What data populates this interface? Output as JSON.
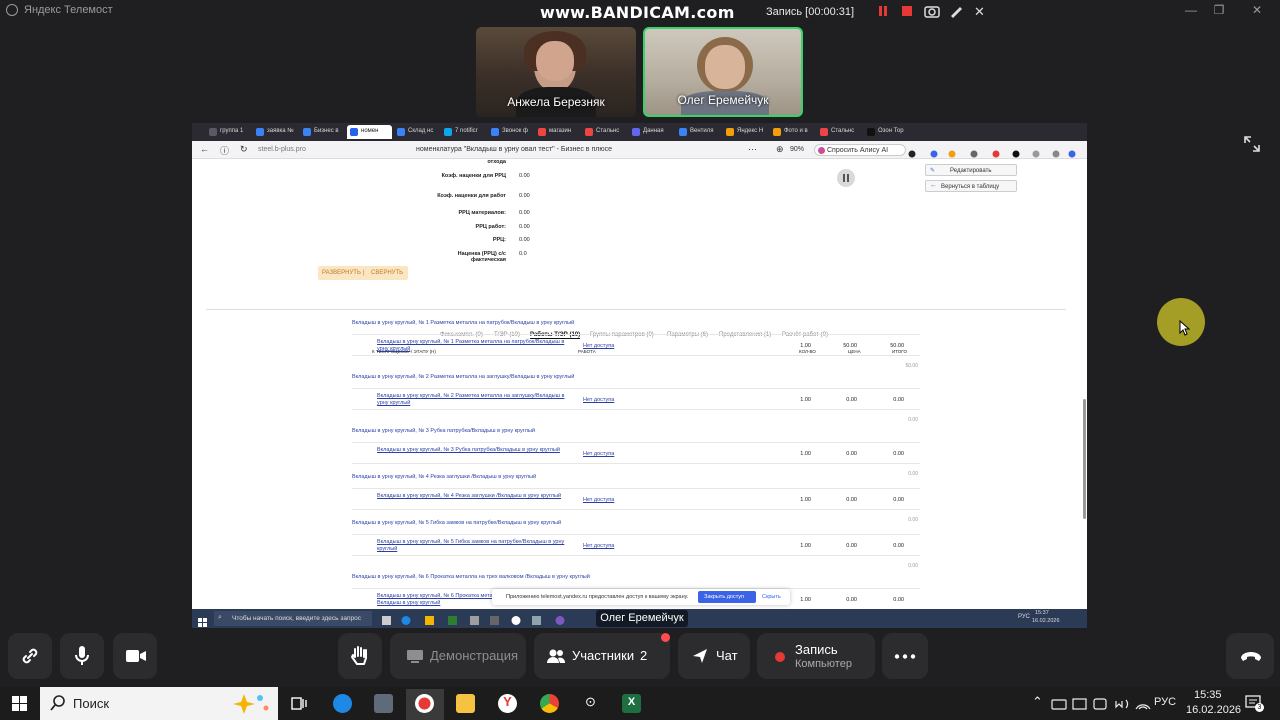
{
  "app": {
    "title": "Яндекс Телемост"
  },
  "bandicam": {
    "brand": "www.BANDICAM.com",
    "recording": "Запись [00:00:31]"
  },
  "participants": [
    {
      "name": "Анжела Березняк"
    },
    {
      "name": "Олег Еремейчук"
    }
  ],
  "shared": {
    "presenter_label": "Олег Еремейчук",
    "tabs": [
      {
        "label": "группа 1",
        "color": "#5a5a66"
      },
      {
        "label": "заявка №",
        "color": "#3b82f6"
      },
      {
        "label": "Бизнес в",
        "color": "#3b82f6"
      },
      {
        "label": "номен",
        "color": "#2563eb"
      },
      {
        "label": "Склад нс",
        "color": "#3b82f6"
      },
      {
        "label": "7 notificr",
        "color": "#0ea5e9"
      },
      {
        "label": "Звонок ф",
        "color": "#3b82f6"
      },
      {
        "label": "магазин",
        "color": "#ef4444"
      },
      {
        "label": "Стальнс",
        "color": "#ef4444"
      },
      {
        "label": "Данная",
        "color": "#6366f1"
      },
      {
        "label": "Вентиля",
        "color": "#3b82f6"
      },
      {
        "label": "Яндекс Н",
        "color": "#f59e0b"
      },
      {
        "label": "Фото и в",
        "color": "#f59e0b"
      },
      {
        "label": "Стальнс",
        "color": "#ef4444"
      },
      {
        "label": "Озон Тор",
        "color": "#111"
      }
    ],
    "url": "steel.b-plus.pro",
    "page_title": "номенклатура \"Вкладыш в урну овал тест\" - Бизнес в плюсе",
    "zoom": "90%",
    "alice": "Спросить Алису AI",
    "fields": [
      {
        "label": "отхода",
        "value": ""
      },
      {
        "label": "Коэф. наценки для РРЦ",
        "value": "0.00"
      },
      {
        "label": "Коэф. наценки для работ",
        "value": "0.00"
      },
      {
        "label": "РРЦ материалов:",
        "value": "0.00"
      },
      {
        "label": "РРЦ работ:",
        "value": "0.00"
      },
      {
        "label": "РРЦ:",
        "value": "0.00"
      },
      {
        "label": "Наценка (РРЦ) с/с фактическая",
        "value": "0.0"
      }
    ],
    "expand": "РАЗВЕРНУТЬ",
    "collapse": "СВЕРНУТЬ",
    "edit_btn": "Редактировать",
    "back_btn": "Вернуться в таблицу",
    "page_tabs": [
      {
        "label": "Фикс.компл. (0)"
      },
      {
        "label": "Т/ЭР (10)"
      },
      {
        "label": "Работы Т/ЭР (10)"
      },
      {
        "label": "Группы параметров (0)"
      },
      {
        "label": "Параметры (6)"
      },
      {
        "label": "Представления (1)"
      },
      {
        "label": "Расчёт работ (0)"
      }
    ],
    "grid_headers": {
      "stage": "К ТЕХПРОЦЕССУ / ЭТАПУ (Н)",
      "work": "РАБОТА",
      "qty": "КОЛ-ВО",
      "price": "ЦЕНА",
      "total": "ИТОГО"
    },
    "groups": [
      {
        "title": "Вкладыш в урну круглый, № 1 Разметка металла на патрубок/Вкладыш в урну круглый",
        "link": "Вкладыш в урну круглый, № 1 Разметка металла на патрубок/Вкладыш в урну круглый",
        "work": "Нет доступа",
        "qty": "1.00",
        "price": "50.00",
        "total": "50.00",
        "sum": "50.00"
      },
      {
        "title": "Вкладыш в урну круглый, № 2 Разметка металла на заглушку/Вкладыш в урну круглый",
        "link": "Вкладыш в урну круглый, № 2 Разметка металла на заглушку/Вкладыш в урну круглый",
        "work": "Нет доступа",
        "qty": "1.00",
        "price": "0.00",
        "total": "0.00",
        "sum": "0.00"
      },
      {
        "title": "Вкладыш в урну круглый, № 3 Рубка патрубка/Вкладыш в урну круглый",
        "link": "Вкладыш в урну круглый, № 3 Рубка патрубка/Вкладыш в урну круглый",
        "work": "Нет доступа",
        "qty": "1.00",
        "price": "0.00",
        "total": "0.00",
        "sum": "0.00"
      },
      {
        "title": "Вкладыш в урну круглый, № 4 Резка заглушки /Вкладыш в урну круглый",
        "link": "Вкладыш в урну круглый, № 4 Резка заглушки /Вкладыш в урну круглый",
        "work": "Нет доступа",
        "qty": "1.00",
        "price": "0.00",
        "total": "0.00",
        "sum": "0.00"
      },
      {
        "title": "Вкладыш в урну круглый, № 5 Гибка замков на патрубке/Вкладыш в урну круглый",
        "link": "Вкладыш в урну круглый, № 5 Гибка замков на патрубке/Вкладыш в урну круглый",
        "work": "Нет доступа",
        "qty": "1.00",
        "price": "0.00",
        "total": "0.00",
        "sum": "0.00"
      },
      {
        "title": "Вкладыш в урну круглый, № 6 Прокатка металла на трех валковом /Вкладыш в урну круглый",
        "link": "Вкладыш в урну круглый, № 6 Прокатка металла на трех валковом /Вкладыш в урну круглый",
        "work": "Нет доступа",
        "qty": "1.00",
        "price": "0.00",
        "total": "0.00",
        "sum": ""
      }
    ],
    "share_notice": "Приложению telemost.yandex.ru предоставлен доступ к вашему экрану.",
    "stop_share": "Закрыть доступ",
    "hide": "Скрыть",
    "inner_search": "Чтобы начать поиск, введите здесь запрос",
    "inner_time": "15:37",
    "inner_date": "16.02.2026",
    "inner_lang": "РУС"
  },
  "controls": {
    "demo": "Демонстрация",
    "participants": "Участники",
    "participants_count": "2",
    "chat": "Чат",
    "record": "Запись",
    "record_sub": "Компьютер"
  },
  "taskbar": {
    "search_placeholder": "Поиск",
    "lang": "РУС",
    "time": "15:35",
    "date": "16.02.2026",
    "notif_count": "3"
  },
  "colors": {
    "accent": "#3a63e6",
    "active_speaker": "#39d36a",
    "record_dot": "#e53935",
    "notify_dot": "#ff4d4f"
  }
}
